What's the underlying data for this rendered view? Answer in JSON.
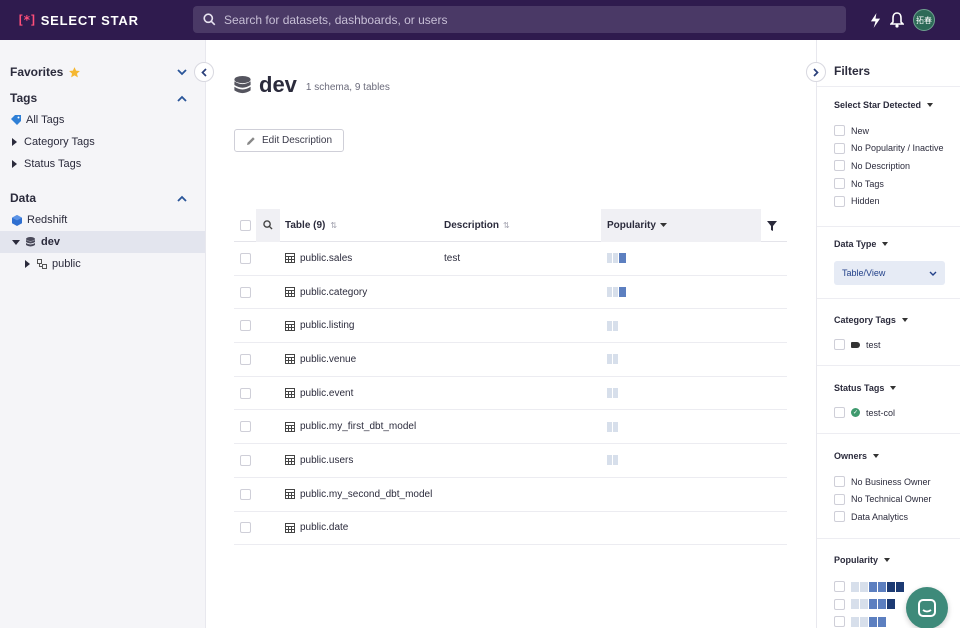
{
  "app": {
    "logo_mark": "[*]",
    "name": "SELECT STAR"
  },
  "search": {
    "placeholder": "Search for datasets, dashboards, or users"
  },
  "user": {
    "avatar_text": "拓春"
  },
  "sidebar": {
    "favorites": "Favorites",
    "tags_title": "Tags",
    "tags": [
      {
        "label": "All Tags"
      },
      {
        "label": "Category Tags"
      },
      {
        "label": "Status Tags"
      }
    ],
    "data_title": "Data",
    "data": {
      "source": "Redshift",
      "database": "dev",
      "schema": "public"
    }
  },
  "page": {
    "title": "dev",
    "subtitle": "1 schema, 9 tables",
    "edit_label": "Edit Description"
  },
  "table": {
    "headers": {
      "name": "Table (9)",
      "description": "Description",
      "popularity": "Popularity"
    },
    "rows": [
      {
        "name": "public.sales",
        "description": "test",
        "popularity": 3
      },
      {
        "name": "public.category",
        "description": "",
        "popularity": 3
      },
      {
        "name": "public.listing",
        "description": "",
        "popularity": 2
      },
      {
        "name": "public.venue",
        "description": "",
        "popularity": 2
      },
      {
        "name": "public.event",
        "description": "",
        "popularity": 2
      },
      {
        "name": "public.my_first_dbt_model",
        "description": "",
        "popularity": 2
      },
      {
        "name": "public.users",
        "description": "",
        "popularity": 2
      },
      {
        "name": "public.my_second_dbt_model",
        "description": "",
        "popularity": 0
      },
      {
        "name": "public.date",
        "description": "",
        "popularity": 0
      }
    ]
  },
  "filters": {
    "title": "Filters",
    "detected": {
      "title": "Select Star Detected",
      "options": [
        "New",
        "No Popularity / Inactive",
        "No Description",
        "No Tags",
        "Hidden"
      ]
    },
    "data_type": {
      "title": "Data Type",
      "value": "Table/View"
    },
    "category_tags": {
      "title": "Category Tags",
      "options": [
        "test"
      ]
    },
    "status_tags": {
      "title": "Status Tags",
      "options": [
        "test-col"
      ]
    },
    "owners": {
      "title": "Owners",
      "options": [
        "No Business Owner",
        "No Technical Owner",
        "Data Analytics"
      ]
    },
    "popularity": {
      "title": "Popularity",
      "levels": [
        6,
        5,
        4
      ]
    }
  },
  "colors": {
    "topbar": "#2f1b4e",
    "pop_light": "#d7dfeb",
    "pop_mid": "#5c7fc0",
    "pop_dark": "#1c3a73"
  }
}
